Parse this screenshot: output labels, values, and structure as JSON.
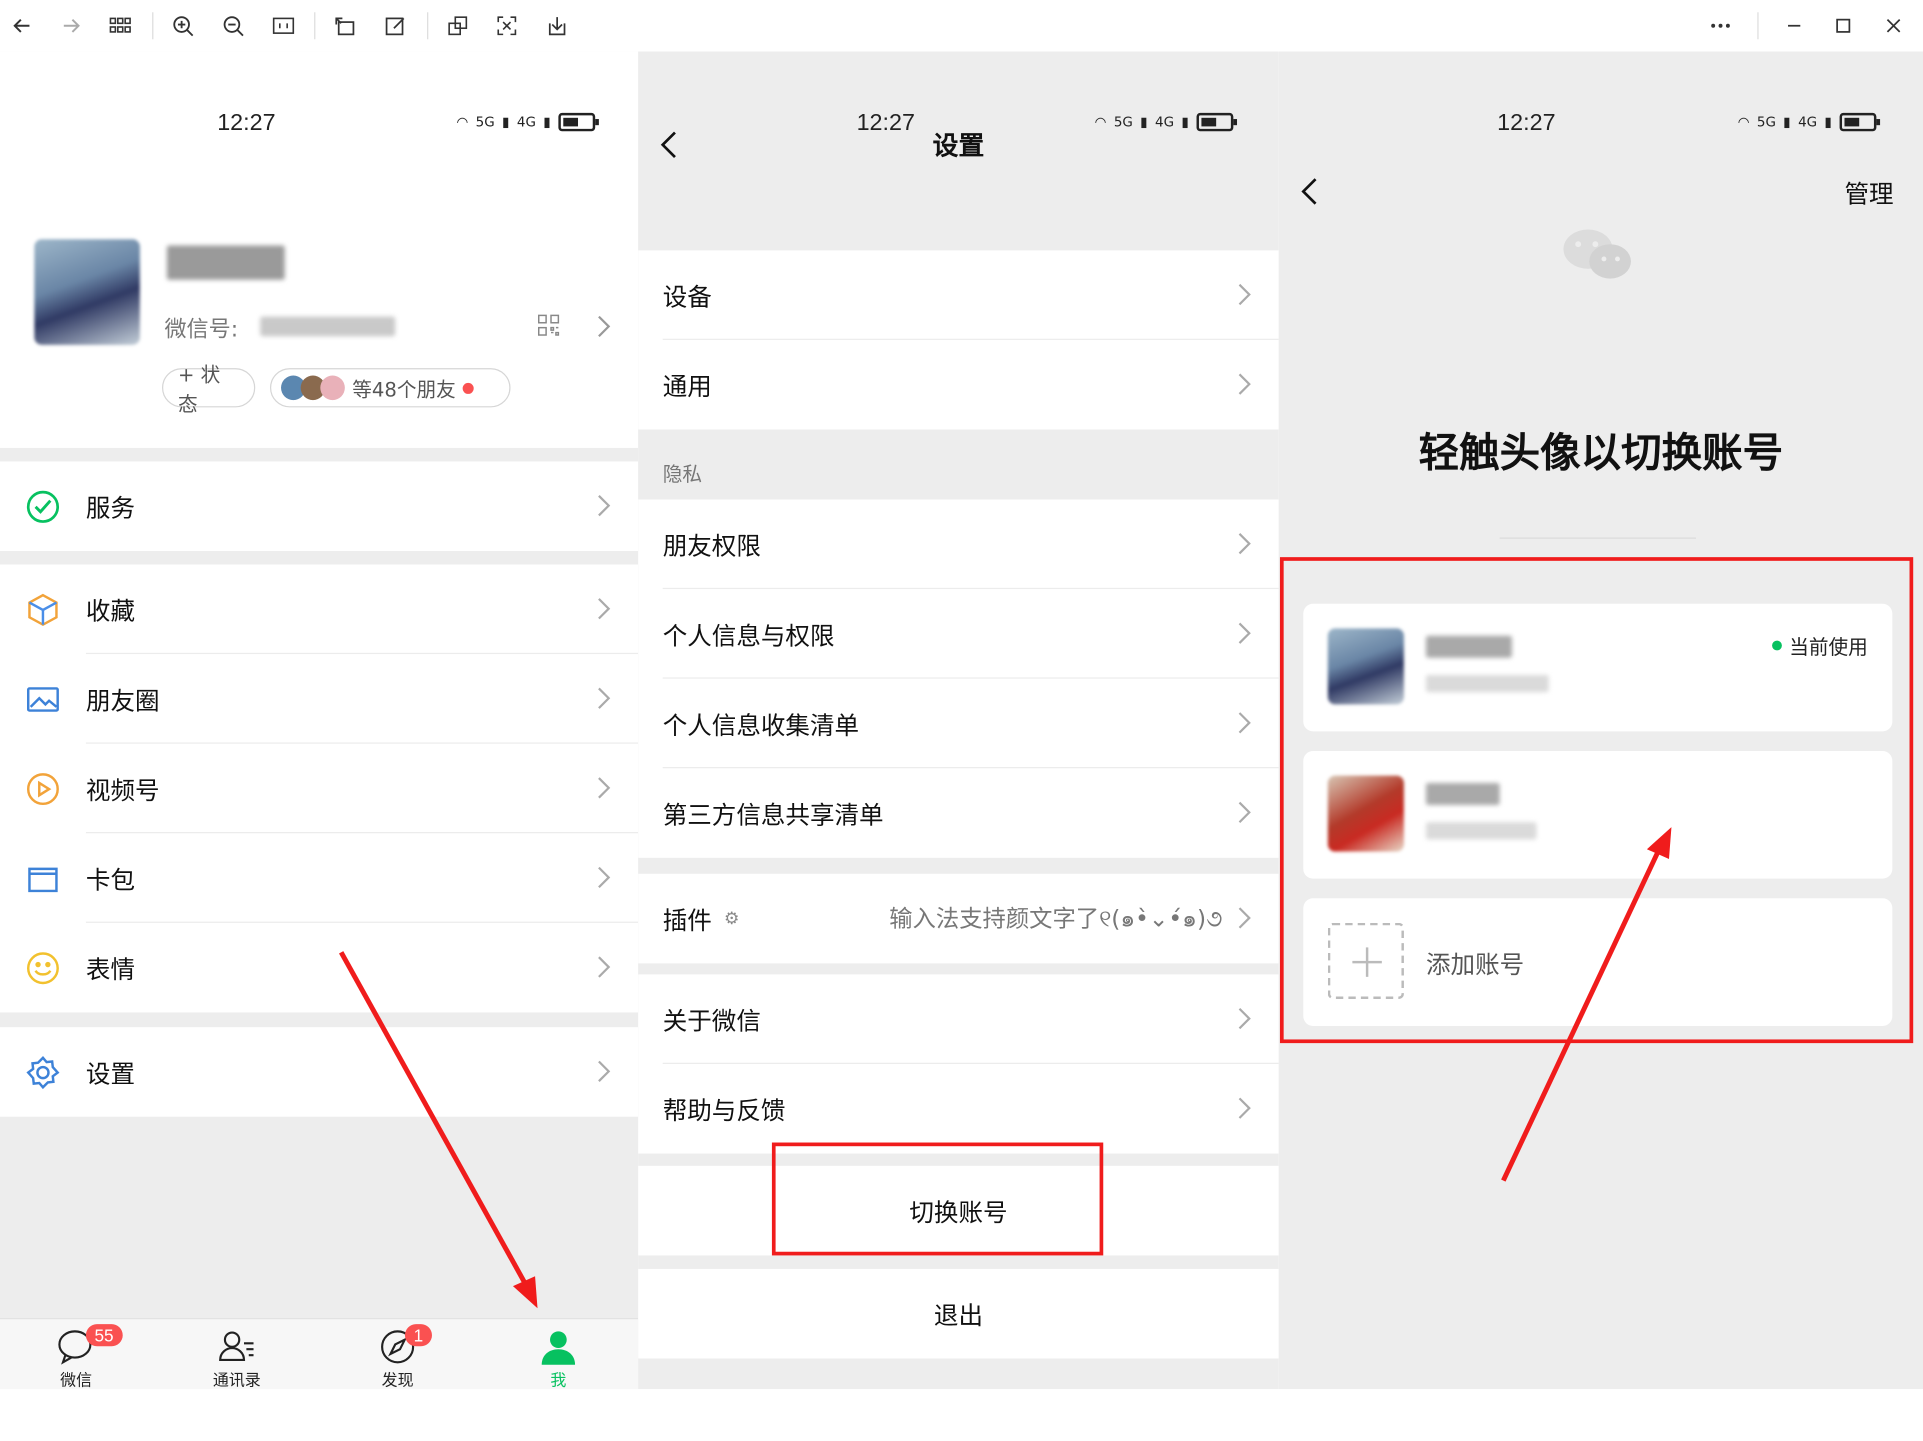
{
  "viewer": {
    "tools": [
      "back-arrow-icon",
      "forward-arrow-icon",
      "grid-icon",
      "zoom-in-icon",
      "zoom-out-icon",
      "actual-size-icon",
      "rotate-icon",
      "edit-icon",
      "crop-icon",
      "fit-screen-icon",
      "download-icon"
    ],
    "window_controls": [
      "more-icon",
      "minimize-icon",
      "maximize-icon",
      "close-icon"
    ]
  },
  "status": {
    "time": "12:27",
    "net1": "5G",
    "net2": "4G"
  },
  "me": {
    "wechat_id_label": "微信号:",
    "status_button": "+ 状态",
    "friends_label": "等48个朋友",
    "menu": [
      {
        "label": "服务",
        "icon": "service-icon"
      },
      {
        "label": "收藏",
        "icon": "favorites-icon"
      },
      {
        "label": "朋友圈",
        "icon": "moments-icon"
      },
      {
        "label": "视频号",
        "icon": "channels-icon"
      },
      {
        "label": "卡包",
        "icon": "card-wallet-icon"
      },
      {
        "label": "表情",
        "icon": "sticker-icon"
      },
      {
        "label": "设置",
        "icon": "settings-gear-icon"
      }
    ],
    "tabs": [
      {
        "label": "微信",
        "badge": "55"
      },
      {
        "label": "通讯录",
        "badge": ""
      },
      {
        "label": "发现",
        "badge": "1"
      },
      {
        "label": "我",
        "badge": ""
      }
    ]
  },
  "settings": {
    "title": "设置",
    "items_top": [
      "设备",
      "通用"
    ],
    "privacy_label": "隐私",
    "items_privacy": [
      "朋友权限",
      "个人信息与权限",
      "个人信息收集清单",
      "第三方信息共享清单"
    ],
    "plugin_label": "插件",
    "plugin_value": "输入法支持颜文字了୧(๑•̀⌄•́๑)૭",
    "items_about": [
      "关于微信",
      "帮助与反馈"
    ],
    "switch_account": "切换账号",
    "logout": "退出"
  },
  "switcher": {
    "manage": "管理",
    "title": "轻触头像以切换账号",
    "current_label": "当前使用",
    "add_account": "添加账号"
  },
  "colors": {
    "accent": "#07c160",
    "annotation": "#f01c1c",
    "badge": "#fa5151"
  }
}
